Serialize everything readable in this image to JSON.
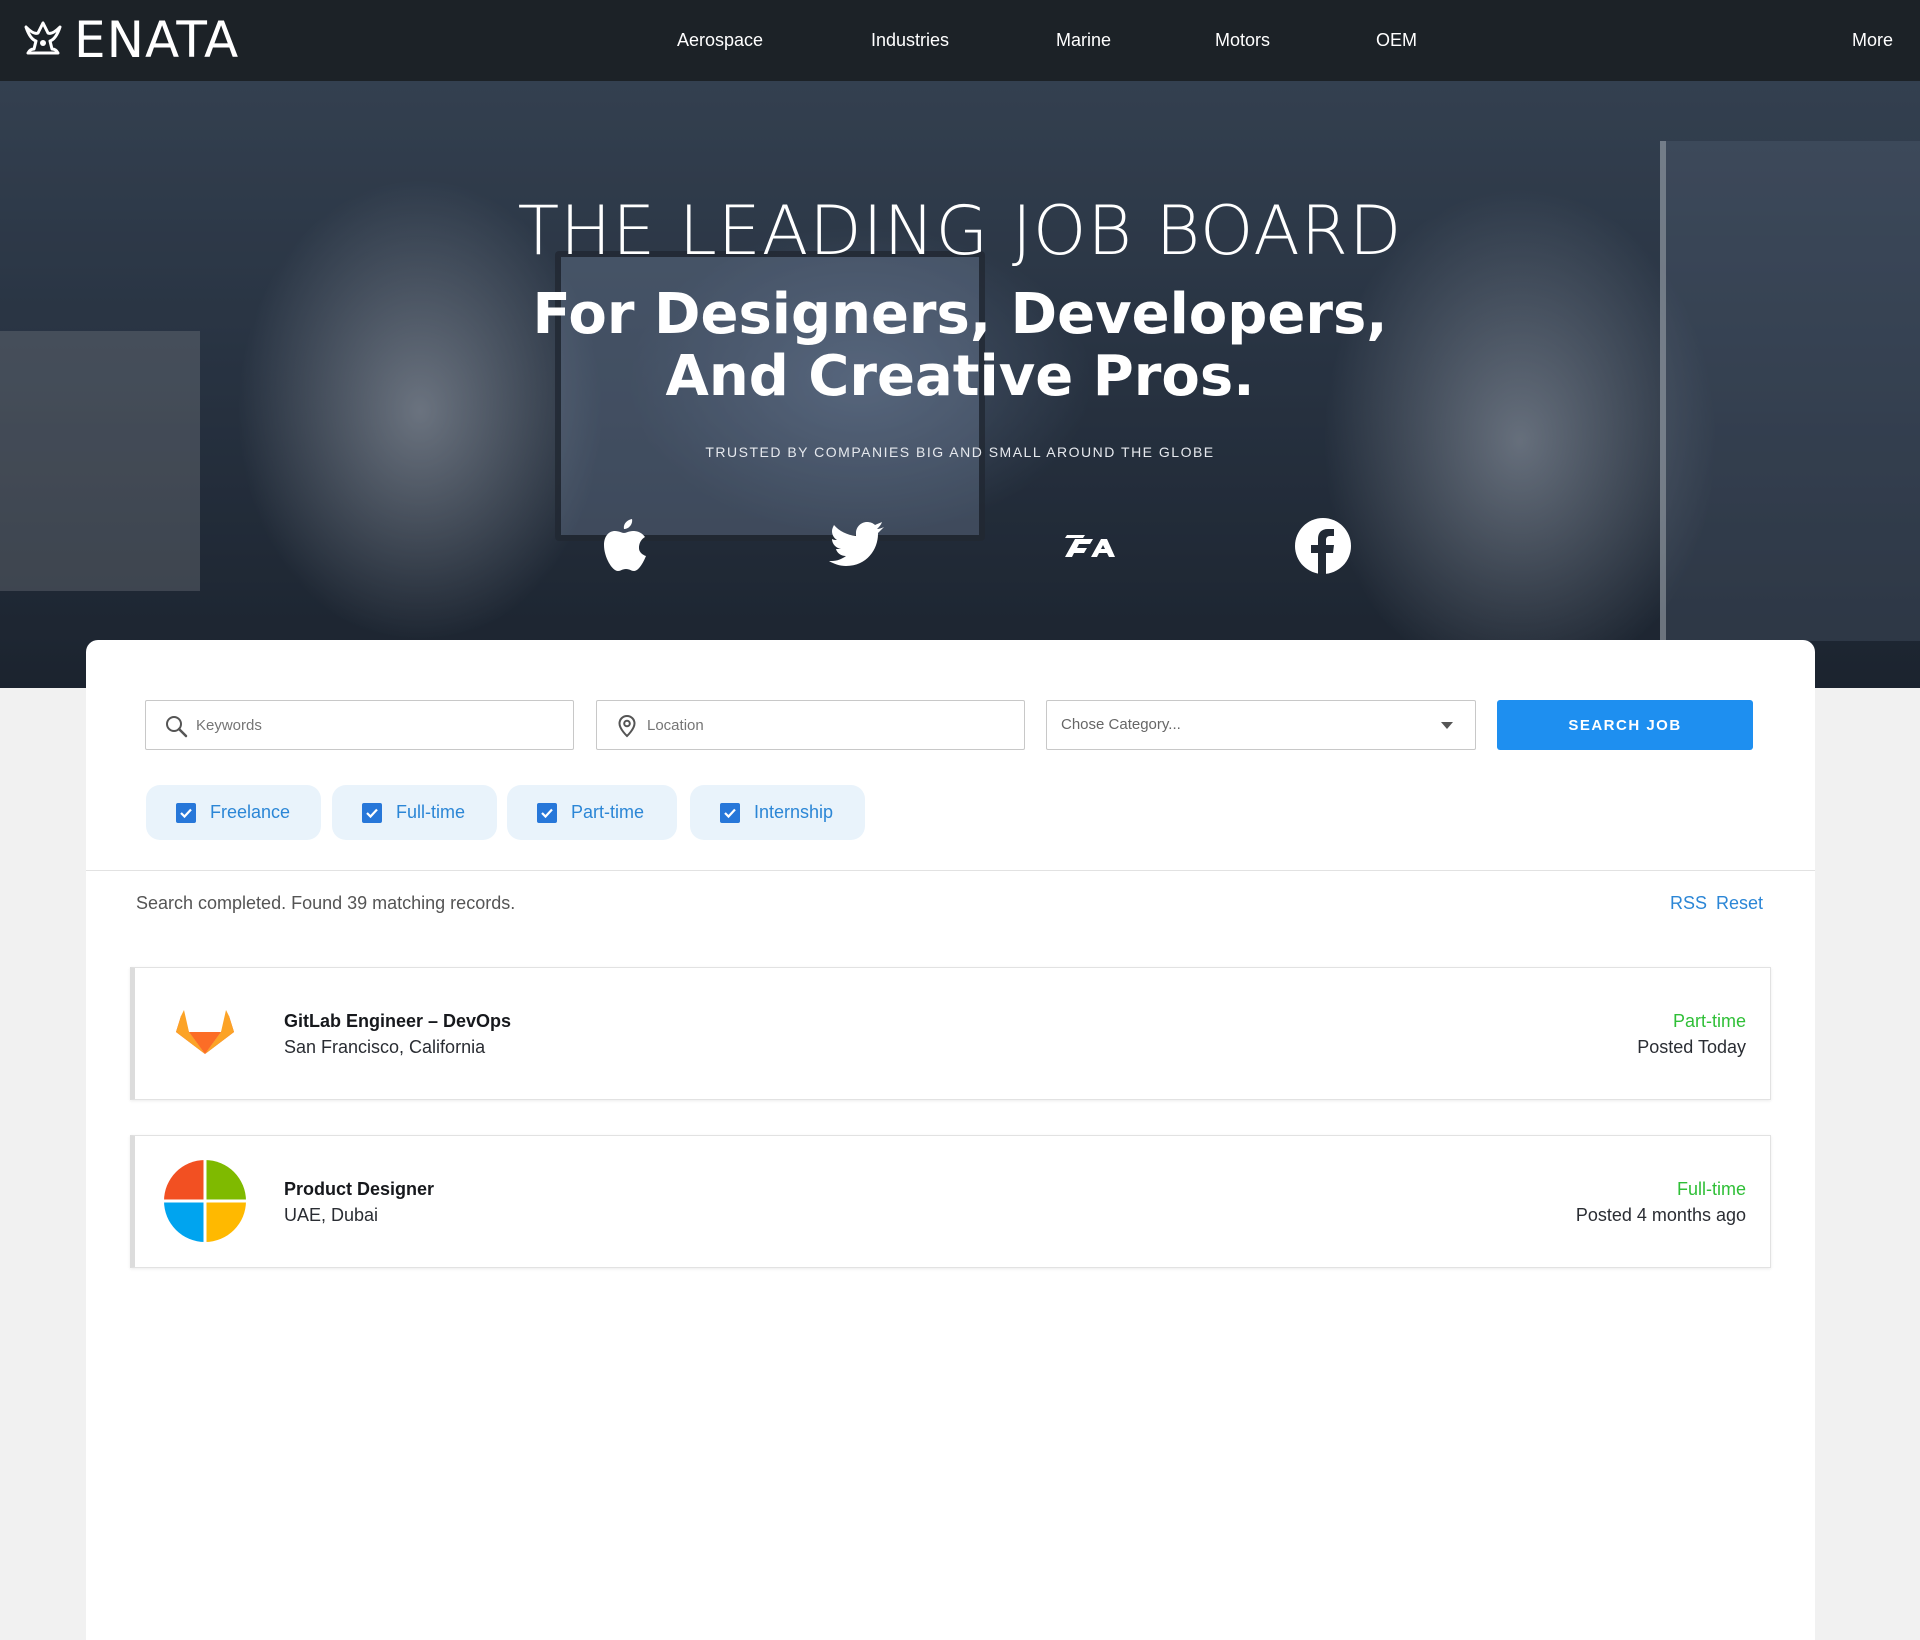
{
  "brand": {
    "name": "ENATA",
    "icon": "crown-anchor-logo"
  },
  "nav": {
    "items": [
      {
        "label": "Aerospace"
      },
      {
        "label": "Industries"
      },
      {
        "label": "Marine"
      },
      {
        "label": "Motors"
      },
      {
        "label": "OEM"
      }
    ],
    "more_label": "More"
  },
  "hero": {
    "kicker": "THE LEADING JOB BOARD",
    "title_line1": "For Designers, Developers,",
    "title_line2": "And Creative Pros.",
    "subtitle": "TRUSTED BY COMPANIES BIG AND SMALL AROUND THE GLOBE",
    "brands": [
      "apple-icon",
      "twitter-icon",
      "ea-icon",
      "facebook-icon"
    ]
  },
  "search": {
    "keywords_placeholder": "Keywords",
    "location_placeholder": "Location",
    "category_placeholder": "Chose Category...",
    "button_label": "SEARCH JOB"
  },
  "filters": [
    {
      "label": "Freelance",
      "checked": true
    },
    {
      "label": "Full-time",
      "checked": true
    },
    {
      "label": "Part-time",
      "checked": true
    },
    {
      "label": "Internship",
      "checked": true
    }
  ],
  "results": {
    "status": "Search completed. Found 39 matching records.",
    "rss_label": "RSS",
    "reset_label": "Reset"
  },
  "jobs": [
    {
      "title": "GitLab Engineer – DevOps",
      "location": "San Francisco, California",
      "type": "Part-time",
      "posted": "Posted Today",
      "logo": "gitlab-logo"
    },
    {
      "title": "Product Designer",
      "location": "UAE, Dubai",
      "type": "Full-time",
      "posted": "Posted 4 months ago",
      "logo": "windows-colors-logo"
    }
  ],
  "colors": {
    "nav_bg": "#1c2227",
    "accent_blue": "#1e8ff0",
    "chip_bg": "#e9f3fb",
    "job_type_green": "#2fbf37"
  }
}
